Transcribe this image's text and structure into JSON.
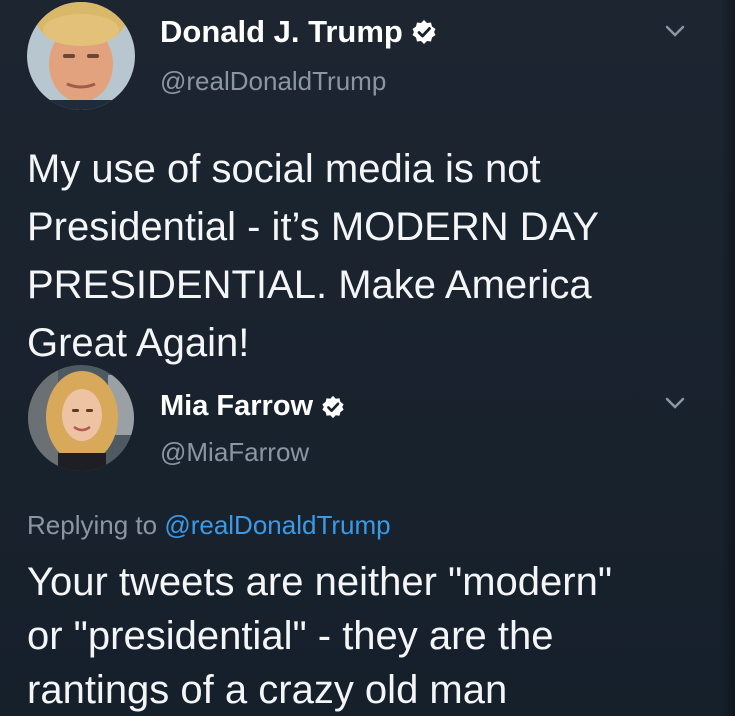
{
  "tweet": {
    "author_name": "Donald J. Trump",
    "author_handle": "@realDonaldTrump",
    "verified": true,
    "avatar_icon": "profile-photo-icon",
    "menu_icon": "chevron-down-icon",
    "text_lines": [
      "My use of social media is not",
      "Presidential - it’s MODERN DAY",
      "PRESIDENTIAL. Make America",
      "Great Again!"
    ]
  },
  "reply": {
    "author_name": "Mia Farrow",
    "author_handle": "@MiaFarrow",
    "verified": true,
    "avatar_icon": "profile-photo-icon",
    "menu_icon": "chevron-down-icon",
    "replying_prefix": "Replying to ",
    "replying_to": "@realDonaldTrump",
    "text_lines": [
      "Your tweets are neither \"modern\"",
      "or \"presidential\" - they are the",
      "rantings of a crazy old man"
    ]
  },
  "colors": {
    "background": "#18202a",
    "text": "#f4f5f7",
    "muted": "#8a96a3",
    "accent": "#3b9ae8"
  }
}
